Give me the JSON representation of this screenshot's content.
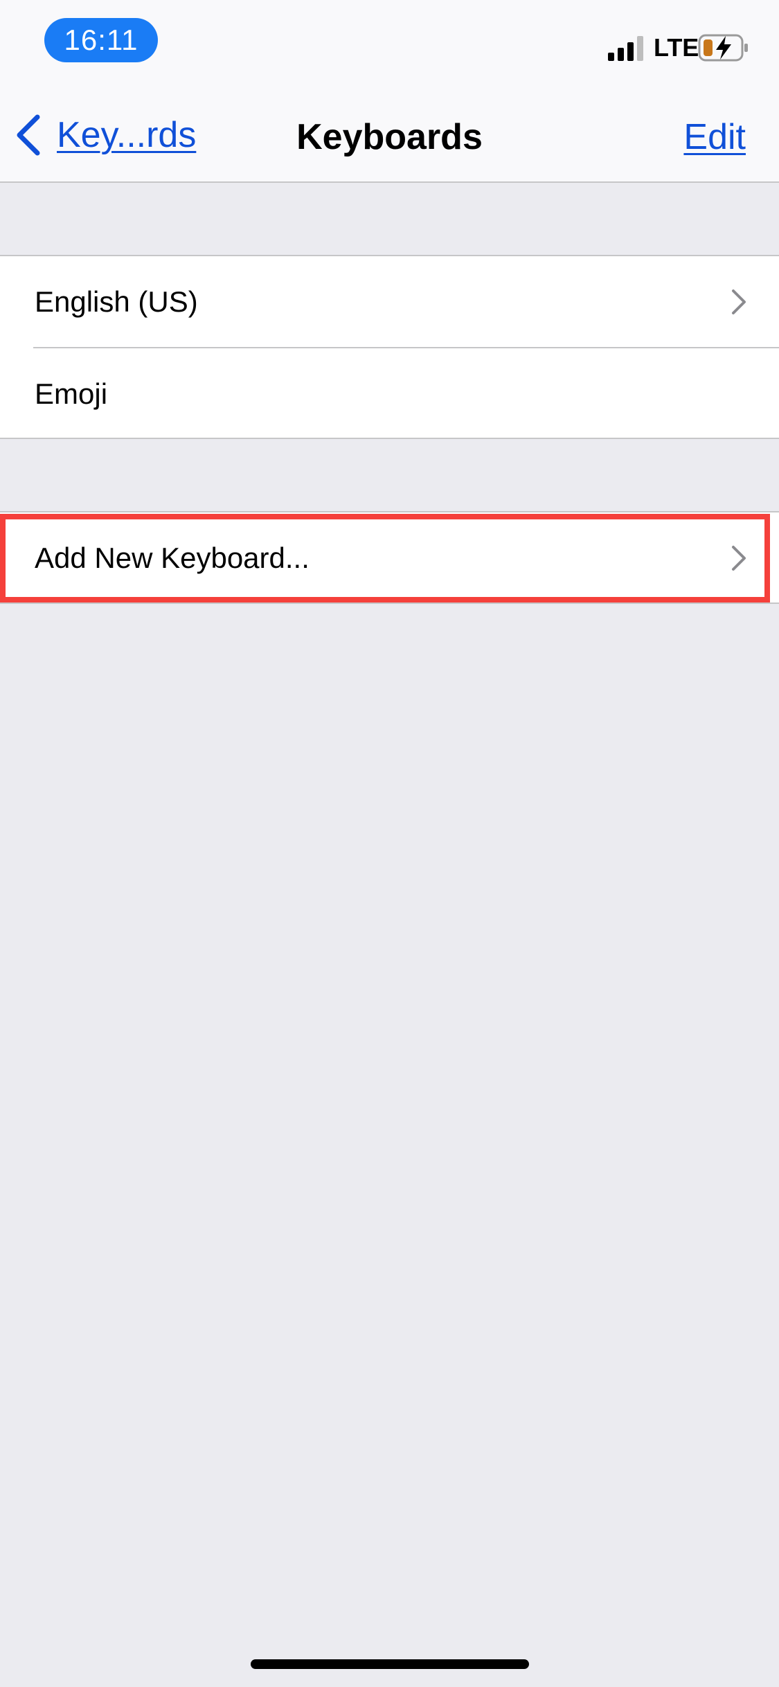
{
  "status_bar": {
    "time": "16:11",
    "network": "LTE",
    "time_pill_color": "#1a7cf5",
    "battery_color": "#c8771a"
  },
  "nav": {
    "back_label": "Key...rds",
    "title": "Keyboards",
    "edit_label": "Edit",
    "link_color": "#1050d8"
  },
  "keyboards": [
    {
      "label": "English (US)",
      "has_chevron": true
    },
    {
      "label": "Emoji",
      "has_chevron": false
    }
  ],
  "add_keyboard": {
    "label": "Add New Keyboard...",
    "highlight_color": "#f5403b"
  }
}
